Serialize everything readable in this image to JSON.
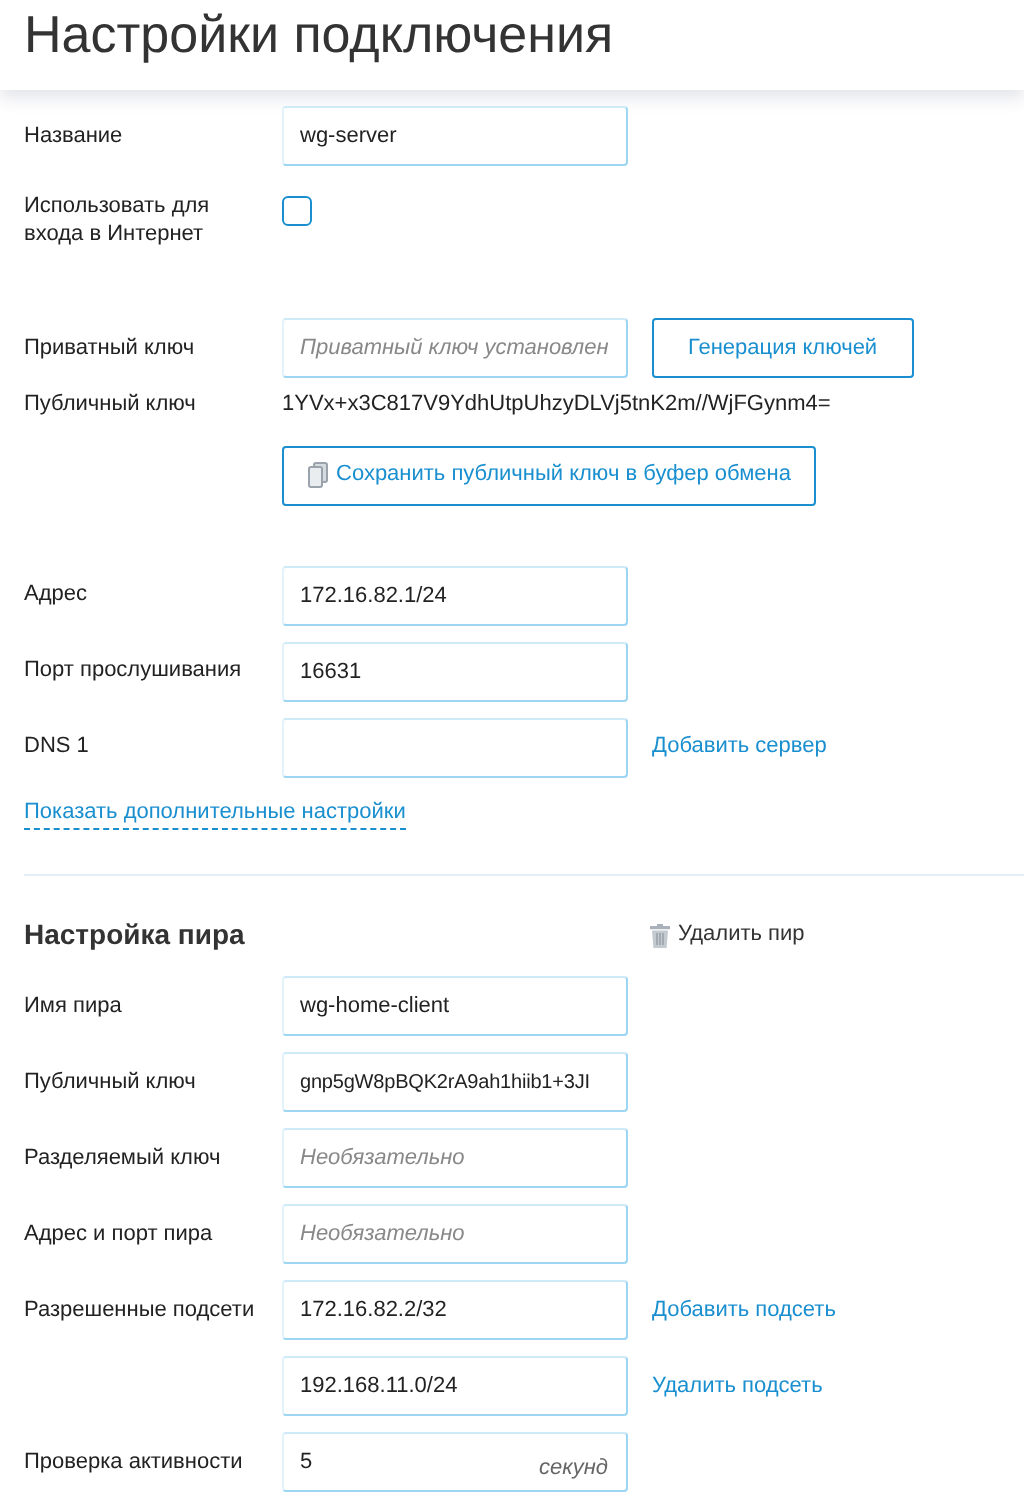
{
  "title": "Настройки подключения",
  "connection": {
    "name": {
      "label": "Название",
      "value": "wg-server"
    },
    "internet": {
      "label": "Использовать для входа в Интернет",
      "checked": false
    },
    "private_key": {
      "label": "Приватный ключ",
      "placeholder": "Приватный ключ установлен",
      "button": "Генерация ключей"
    },
    "public_key": {
      "label": "Публичный ключ",
      "value": "1YVx+x3C817V9YdhUtpUhzyDLVj5tnK2m//WjFGynm4="
    },
    "copy_button": "Сохранить публичный ключ в буфер обмена",
    "fields": [
      {
        "label": "Адрес",
        "value": "172.16.82.1/24"
      },
      {
        "label": "Порт прослушивания",
        "value": "16631"
      },
      {
        "label": "DNS 1",
        "action": "Добавить сервер"
      }
    ],
    "more_link": "Показать дополнительные настройки"
  },
  "peer": {
    "title": "Настройка пира",
    "delete_button": "Удалить пир",
    "fields": [
      {
        "label": "Имя пира",
        "value": "wg-home-client"
      },
      {
        "label": "Публичный ключ",
        "value": "gnp5gW8pBQK2rA9ah1hiib1+3JI"
      },
      {
        "label": "Разделяемый ключ",
        "placeholder": "Необязательно"
      },
      {
        "label": "Адрес и порт пира",
        "placeholder": "Необязательно"
      },
      {
        "label": "Разрешенные подсети",
        "value": "172.16.82.2/32",
        "action": "Добавить подсеть"
      },
      {
        "value": "192.168.11.0/24",
        "action": "Удалить подсеть"
      },
      {
        "label": "Проверка активности",
        "value": "5",
        "unit": "секунд"
      }
    ]
  }
}
